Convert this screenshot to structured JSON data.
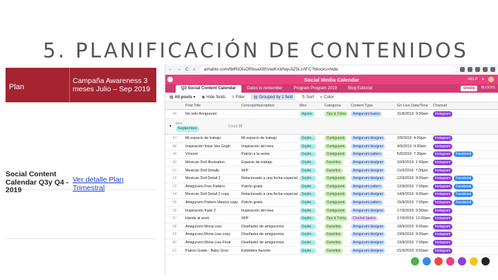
{
  "slide": {
    "title": "5. PLANIFICACIÓN DE CONTENIDOS"
  },
  "left_table": {
    "header": {
      "col1": "Plan",
      "col2": "Campaña Awareness 3 meses Julio – Sep 2019"
    },
    "row": {
      "col1": "Social Content Calendar Q3y Q4 - 2019",
      "link": "Ver detalle Plan Trimestral"
    }
  },
  "browser": {
    "url": "airtable.com/tblRiOlsORbsaX8f/viwKXbNqs3Z5LzAFC?blocks=hide",
    "app_title": "Social Media Calendar",
    "help": "HELP",
    "tabs": [
      "Q3 Social Content Calendar",
      "Dates to remember",
      "Program Program 2019",
      "Blog Editorial"
    ],
    "share": "SHARE",
    "blocks": "BLOCKS",
    "toolbar": {
      "view": "All posts",
      "hide": "Hide fields",
      "filter": "Filter",
      "group": "Grouped by 1 field",
      "sort": "Sort",
      "color": "Color"
    },
    "columns": [
      "Post Title",
      "Concept/description",
      "Mes",
      "Categoría",
      "Content Type",
      "Go Live Date/Time",
      "Channel"
    ],
    "first_row": {
      "num": "46",
      "title": "No solo Amigurumi",
      "mes": "Agosto",
      "cat": "Tips & Tricks",
      "type": "Amigurumi basics",
      "date": "31/8/2019",
      "time": "9:00am",
      "channels": [
        "Instagram"
      ]
    },
    "group": {
      "label": "MES",
      "value": "Septiembre",
      "count_label": "Count",
      "count": "19"
    },
    "rows": [
      {
        "num": "47",
        "title": "Mi espacio de trabajo",
        "concept": "Mi espacio de trabajo",
        "mes": "Septie...",
        "cat": "Yumigurumi",
        "type": "Amigurumi designer",
        "date": "2/9/2019",
        "time": "4:00pm",
        "channels": [
          "Instagram"
        ]
      },
      {
        "num": "48",
        "title": "Inspiración frase Van Gogh",
        "concept": "Inspiración del mes",
        "mes": "Septie...",
        "cat": "Yumigurumi",
        "type": "Amigurumi designer",
        "date": "4/9/2019",
        "time": "9:30am",
        "channels": [
          "Instagram"
        ]
      },
      {
        "num": "49",
        "title": "Vincent",
        "concept": "Patrón a la venta",
        "mes": "Septie...",
        "cat": "Yumigurumi",
        "type": "Amigurumi pattern",
        "date": "5/9/2019",
        "time": "7:30pm",
        "channels": [
          "Instagram",
          "Facebook"
        ]
      },
      {
        "num": "50",
        "title": "Mexican Doll Illustration",
        "concept": "Espacio de trabajo",
        "mes": "Septie...",
        "cat": "Favoritos",
        "type": "Amigurumi designer",
        "date": "10/9/2019",
        "time": "1:43pm",
        "channels": [
          "Instagram"
        ]
      },
      {
        "num": "51",
        "title": "Mexican Doll Detalle",
        "concept": "WIP",
        "mes": "Septie...",
        "cat": "Favoritos",
        "type": "Amigurumi designer",
        "date": "11/9/2019",
        "time": "7:30pm",
        "channels": [
          "Instagram"
        ]
      },
      {
        "num": "52",
        "title": "Mexican Doll Detail 2",
        "concept": "Relacionado a una fecha especial",
        "mes": "Septie...",
        "cat": "Yumigurumi",
        "type": "Amigurumi designer",
        "date": "12/9/2019",
        "time": "9:00am",
        "channels": [
          "Instagram",
          "Facebook"
        ]
      },
      {
        "num": "53",
        "title": "Amigurumi Free Pattern",
        "concept": "Patrón gratis",
        "mes": "Septie...",
        "cat": "Yumigurumi",
        "type": "Amigurumi pattern",
        "date": "12/9/2019",
        "time": "7:00pm",
        "channels": [
          "Instagram",
          "Facebook"
        ]
      },
      {
        "num": "54",
        "title": "Mexican Doll Detail 2 copy",
        "concept": "Relacionado a una fecha especial",
        "mes": "Septie...",
        "cat": "Yumigurumi",
        "type": "Amigurumi designer",
        "date": "14/9/2019",
        "time": "9:00am",
        "channels": [
          "Instagram",
          "Facebook"
        ]
      },
      {
        "num": "55",
        "title": "Amigurumi Pattern Mexico copy",
        "concept": "Patrón gratis",
        "mes": "Septie...",
        "cat": "Yumigurumi",
        "type": "Amigurumi pattern",
        "date": "15/9/2019",
        "time": "7:00pm",
        "channels": [
          "Instagram",
          "Facebook"
        ]
      },
      {
        "num": "56",
        "title": "Inspiración frase 2",
        "concept": "Inspiración del mes",
        "mes": "Septie...",
        "cat": "Yumigurumi",
        "type": "Amigurumi designer",
        "date": "17/9/2019",
        "time": "9:30am",
        "channels": [
          "Instagram"
        ]
      },
      {
        "num": "57",
        "title": "Hands at work",
        "concept": "WIP",
        "mes": "Septie...",
        "cat": "Tips & Tricks",
        "type": "Crochet basics",
        "date": "17/9/2019",
        "time": "12:00pm",
        "channels": [
          "Instagram"
        ]
      },
      {
        "num": "58",
        "title": "Amigurumi Mona Lisa",
        "concept": "Diseñador de amigurumis",
        "mes": "Septie...",
        "cat": "Favoritos",
        "type": "Amigurumi designer",
        "date": "18/9/2019",
        "time": "9:00am",
        "channels": [
          "Instagram"
        ]
      },
      {
        "num": "59",
        "title": "Amigurumi Mona Lisa copy",
        "concept": "Diseñador de amigurumis",
        "mes": "Septie...",
        "cat": "Favoritos",
        "type": "Amigurumi designer",
        "date": "19/9/2019",
        "time": "9:00am",
        "channels": [
          "Instagram"
        ]
      },
      {
        "num": "60",
        "title": "Amigurumi Mona Lisa Final",
        "concept": "Diseñador de amigurumis",
        "mes": "Septie...",
        "cat": "Favoritos",
        "type": "Amigurumi designer",
        "date": "19/9/2019",
        "time": "7:00pm",
        "channels": [
          "Instagram"
        ]
      },
      {
        "num": "61",
        "title": "Patron Gratis - Baby Groo",
        "concept": "Estambre favorito",
        "mes": "Septie...",
        "cat": "Favoritos",
        "type": "Amigurumi designer",
        "date": "21/9/2019",
        "time": "9:00am",
        "channels": [
          "Instagram"
        ]
      }
    ]
  },
  "colors": {
    "accent": "#a52431",
    "airtable_pink": "#e8427f",
    "instagram": "#8b3fd6",
    "facebook": "#3b8ae3"
  },
  "bottom_icons": [
    "#4caf50",
    "#3b8ae3",
    "#e84a4a",
    "#e8427f",
    "#8b3fd6",
    "#f5c518",
    "#222222"
  ]
}
